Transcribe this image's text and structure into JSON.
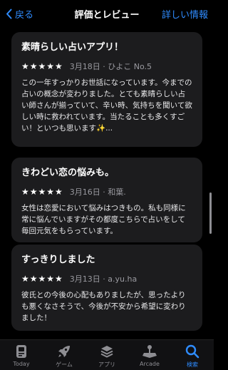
{
  "nav": {
    "back_label": "戻る",
    "title": "評価とレビュー",
    "details_label": "詳しい情報"
  },
  "reviews": [
    {
      "title": "素晴らしい占いアプリ！",
      "stars": "★★★★★",
      "date": "3月18日",
      "author": "ひよこ No.5",
      "body": "この一年すっかりお世話になっています。今までの占いの概念が変わりました。とても素晴らしい占い師さんが揃っていて、辛い時、気持ちを聞いて欲しい時に救われています。当たることも多くすごい！といつも思います✨..."
    },
    {
      "title": "きわどい恋の悩みも。",
      "stars": "★★★★★",
      "date": "3月16日",
      "author": "和葉.",
      "body": "女性は恋愛において悩みはつきもの。私も同様に常に悩んでいますがその都度こちらで占いをして毎回元気をもらっています。"
    },
    {
      "title": "すっきりしました",
      "stars": "★★★★★",
      "date": "3月13日",
      "author": "a.yu.ha",
      "body": "彼氏との今後の心配もありましたが、思ったよりも悪くなさそうで、今後が不安から希望に変わりました！"
    }
  ],
  "tabs": [
    {
      "label": "Today",
      "icon": "today-icon"
    },
    {
      "label": "ゲーム",
      "icon": "rocket-icon"
    },
    {
      "label": "アプリ",
      "icon": "layers-icon"
    },
    {
      "label": "Arcade",
      "icon": "joystick-icon"
    },
    {
      "label": "検索",
      "icon": "search-icon",
      "active": true
    }
  ],
  "colors": {
    "accent": "#2f8cff",
    "card": "#1c1c1e",
    "background": "#000000"
  }
}
